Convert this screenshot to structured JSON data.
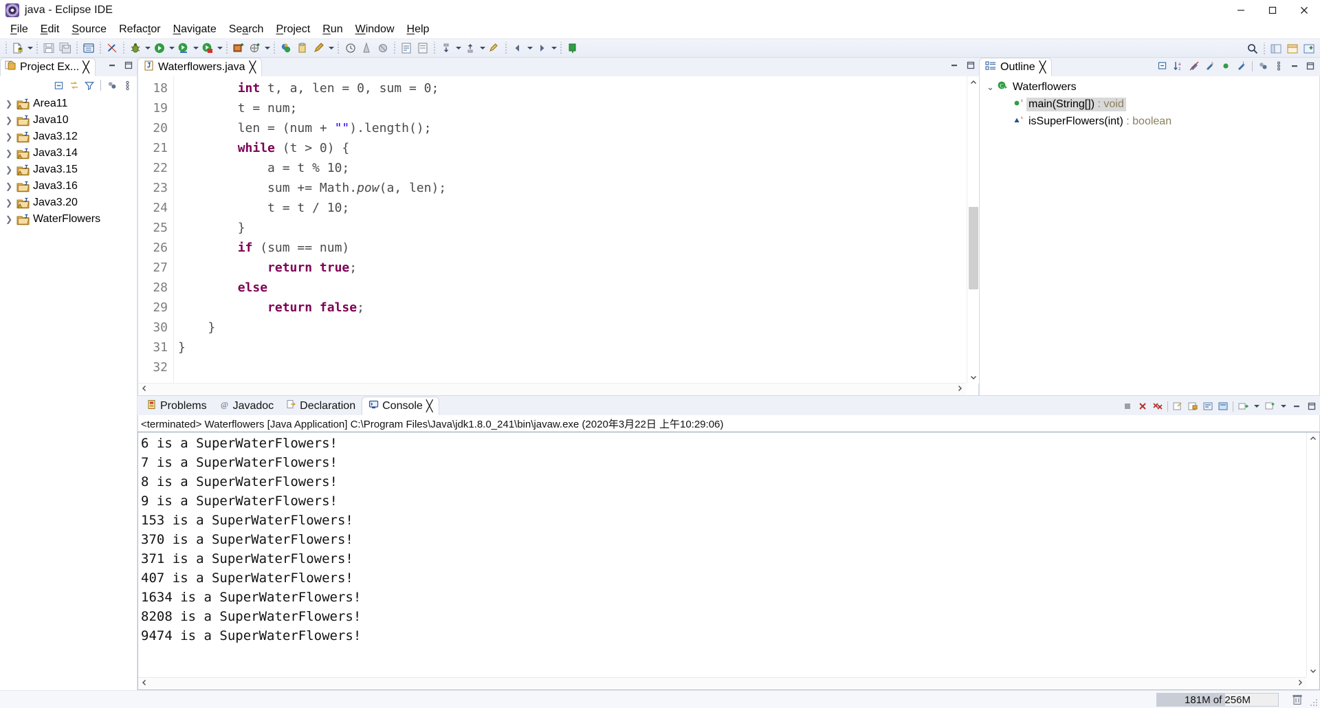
{
  "window": {
    "title": "java - Eclipse IDE",
    "icon": "eclipse-icon",
    "minimize": "minimize-button",
    "maximize": "maximize-button",
    "close": "close-button"
  },
  "menubar": {
    "items": [
      {
        "label": "File",
        "mnemonic": "F"
      },
      {
        "label": "Edit",
        "mnemonic": "E"
      },
      {
        "label": "Source",
        "mnemonic": "S"
      },
      {
        "label": "Refactor",
        "mnemonic": "t"
      },
      {
        "label": "Navigate",
        "mnemonic": "N"
      },
      {
        "label": "Search",
        "mnemonic": "a"
      },
      {
        "label": "Project",
        "mnemonic": "P"
      },
      {
        "label": "Run",
        "mnemonic": "R"
      },
      {
        "label": "Window",
        "mnemonic": "W"
      },
      {
        "label": "Help",
        "mnemonic": "H"
      }
    ]
  },
  "toolbar": {
    "buttons": [
      "new-wizard-icon",
      "save-icon",
      "save-all-icon",
      "print-icon",
      "toggle-console-icon",
      "link-editor-icon",
      "debug-icon",
      "run-icon",
      "run-external-icon",
      "coverage-icon",
      "new-java-project-icon",
      "new-java-package-icon",
      "new-class-icon",
      "new-annotation-icon",
      "search-icon",
      "history-icon",
      "annotate-icon",
      "open-task-icon",
      "open-type-icon",
      "next-annotation-icon",
      "previous-annotation-icon",
      "last-edit-icon",
      "back-icon",
      "forward-icon",
      "pin-editor-icon"
    ],
    "right_buttons": [
      "quick-access-search-icon",
      "java-perspective-icon",
      "java-ee-perspective-icon",
      "open-perspective-icon"
    ]
  },
  "project_explorer": {
    "tab_label": "Project Ex...",
    "tab_icon": "project-explorer-icon",
    "close_label": "╳",
    "tools": [
      "collapse-all-icon",
      "link-with-editor-icon",
      "view-filter-icon",
      "view-presentation-icon",
      "view-menu-icon"
    ],
    "items": [
      {
        "label": "Area11",
        "icon": "java-project-warning-icon"
      },
      {
        "label": "Java10",
        "icon": "java-project-icon"
      },
      {
        "label": "Java3.12",
        "icon": "java-project-icon"
      },
      {
        "label": "Java3.14",
        "icon": "java-project-warning-icon"
      },
      {
        "label": "Java3.15",
        "icon": "java-project-warning-icon"
      },
      {
        "label": "Java3.16",
        "icon": "java-project-icon"
      },
      {
        "label": "Java3.20",
        "icon": "java-project-warning-icon"
      },
      {
        "label": "WaterFlowers",
        "icon": "java-project-icon"
      }
    ]
  },
  "editor": {
    "tab_label": "Waterflowers.java",
    "tab_icon": "java-file-icon",
    "close_label": "╳",
    "minimize_label": "minimize-icon",
    "maximize_label": "maximize-icon",
    "first_line_number": 18,
    "lines": [
      {
        "n": 18,
        "tokens": [
          {
            "t": "        ",
            "c": "punc"
          },
          {
            "t": "int",
            "c": "kw"
          },
          {
            "t": " t, a, len = 0, sum = 0;",
            "c": "punc"
          }
        ]
      },
      {
        "n": 19,
        "tokens": [
          {
            "t": "        t = num;",
            "c": "punc"
          }
        ]
      },
      {
        "n": 20,
        "tokens": [
          {
            "t": "        len = (num + ",
            "c": "punc"
          },
          {
            "t": "\"\"",
            "c": "str"
          },
          {
            "t": ").length();",
            "c": "punc"
          }
        ]
      },
      {
        "n": 21,
        "tokens": [
          {
            "t": "        ",
            "c": "punc"
          },
          {
            "t": "while",
            "c": "kw"
          },
          {
            "t": " (t > 0) {",
            "c": "punc"
          }
        ]
      },
      {
        "n": 22,
        "tokens": [
          {
            "t": "            a = t % 10;",
            "c": "punc"
          }
        ]
      },
      {
        "n": 23,
        "tokens": [
          {
            "t": "            sum += Math.",
            "c": "punc"
          },
          {
            "t": "pow",
            "c": "mth"
          },
          {
            "t": "(a, len);",
            "c": "punc"
          }
        ]
      },
      {
        "n": 24,
        "tokens": [
          {
            "t": "            t = t / 10;",
            "c": "punc"
          }
        ]
      },
      {
        "n": 25,
        "tokens": [
          {
            "t": "        }",
            "c": "punc"
          }
        ]
      },
      {
        "n": 26,
        "tokens": [
          {
            "t": "        ",
            "c": "punc"
          },
          {
            "t": "if",
            "c": "kw"
          },
          {
            "t": " (sum == num)",
            "c": "punc"
          }
        ]
      },
      {
        "n": 27,
        "tokens": [
          {
            "t": "            ",
            "c": "punc"
          },
          {
            "t": "return true",
            "c": "kw"
          },
          {
            "t": ";",
            "c": "punc"
          }
        ]
      },
      {
        "n": 28,
        "tokens": [
          {
            "t": "        ",
            "c": "punc"
          },
          {
            "t": "else",
            "c": "kw"
          }
        ]
      },
      {
        "n": 29,
        "tokens": [
          {
            "t": "            ",
            "c": "punc"
          },
          {
            "t": "return false",
            "c": "kw"
          },
          {
            "t": ";",
            "c": "punc"
          }
        ]
      },
      {
        "n": 30,
        "tokens": [
          {
            "t": "    }",
            "c": "punc"
          }
        ]
      },
      {
        "n": 31,
        "tokens": [
          {
            "t": "}",
            "c": "punc"
          }
        ]
      },
      {
        "n": 32,
        "tokens": [
          {
            "t": "",
            "c": "punc"
          }
        ]
      }
    ]
  },
  "outline": {
    "tab_label": "Outline",
    "tab_icon": "outline-icon",
    "close_label": "╳",
    "tools": [
      "collapse-all-icon",
      "sort-icon",
      "hide-fields-icon",
      "hide-static-icon",
      "hide-nonpublic-icon",
      "hide-local-types-icon",
      "view-presentation-icon",
      "view-menu-icon",
      "minimize-icon",
      "maximize-icon"
    ],
    "items": [
      {
        "label": "Waterflowers",
        "icon": "class-icon",
        "type": "",
        "indent": 0,
        "selected": false,
        "expander": "chevron-down-icon",
        "static": false
      },
      {
        "label": "main(String[])",
        "icon": "public-method-icon",
        "type": " : void",
        "indent": 1,
        "selected": true,
        "expander": "",
        "static": true
      },
      {
        "label": "isSuperFlowers(int)",
        "icon": "private-method-icon",
        "type": " : boolean",
        "indent": 1,
        "selected": false,
        "expander": "",
        "static": true
      }
    ]
  },
  "console": {
    "tabs": [
      {
        "label": "Problems",
        "icon": "problems-icon",
        "active": false
      },
      {
        "label": "Javadoc",
        "icon": "javadoc-icon",
        "active": false
      },
      {
        "label": "Declaration",
        "icon": "declaration-icon",
        "active": false
      },
      {
        "label": "Console",
        "icon": "console-icon",
        "active": true
      }
    ],
    "close_label": "╳",
    "tools": [
      "terminate-icon",
      "remove-launch-icon",
      "remove-all-terminated-icon",
      "open-console-icon",
      "clear-console-icon",
      "scroll-lock-icon",
      "word-wrap-icon",
      "pin-console-icon",
      "display-selected-console-icon",
      "open-console-menu-icon",
      "new-console-view-icon",
      "view-menu-icon",
      "minimize-icon",
      "maximize-icon"
    ],
    "header": "<terminated> Waterflowers [Java Application] C:\\Program Files\\Java\\jdk1.8.0_241\\bin\\javaw.exe (2020年3月22日 上午10:29:06)",
    "output": [
      "6 is a SuperWaterFlowers!",
      "7 is a SuperWaterFlowers!",
      "8 is a SuperWaterFlowers!",
      "9 is a SuperWaterFlowers!",
      "153 is a SuperWaterFlowers!",
      "370 is a SuperWaterFlowers!",
      "371 is a SuperWaterFlowers!",
      "407 is a SuperWaterFlowers!",
      "1634 is a SuperWaterFlowers!",
      "8208 is a SuperWaterFlowers!",
      "9474 is a SuperWaterFlowers!"
    ]
  },
  "statusbar": {
    "heap_label": "181M of 256M",
    "trash_icon": "run-garbage-collector-icon"
  },
  "colors": {
    "keyword": "#7f0055",
    "string": "#2a00ff",
    "tab_active_bg": "#ffffff",
    "panel_bg": "#eef1f8",
    "selection": "#d9d9d9"
  }
}
